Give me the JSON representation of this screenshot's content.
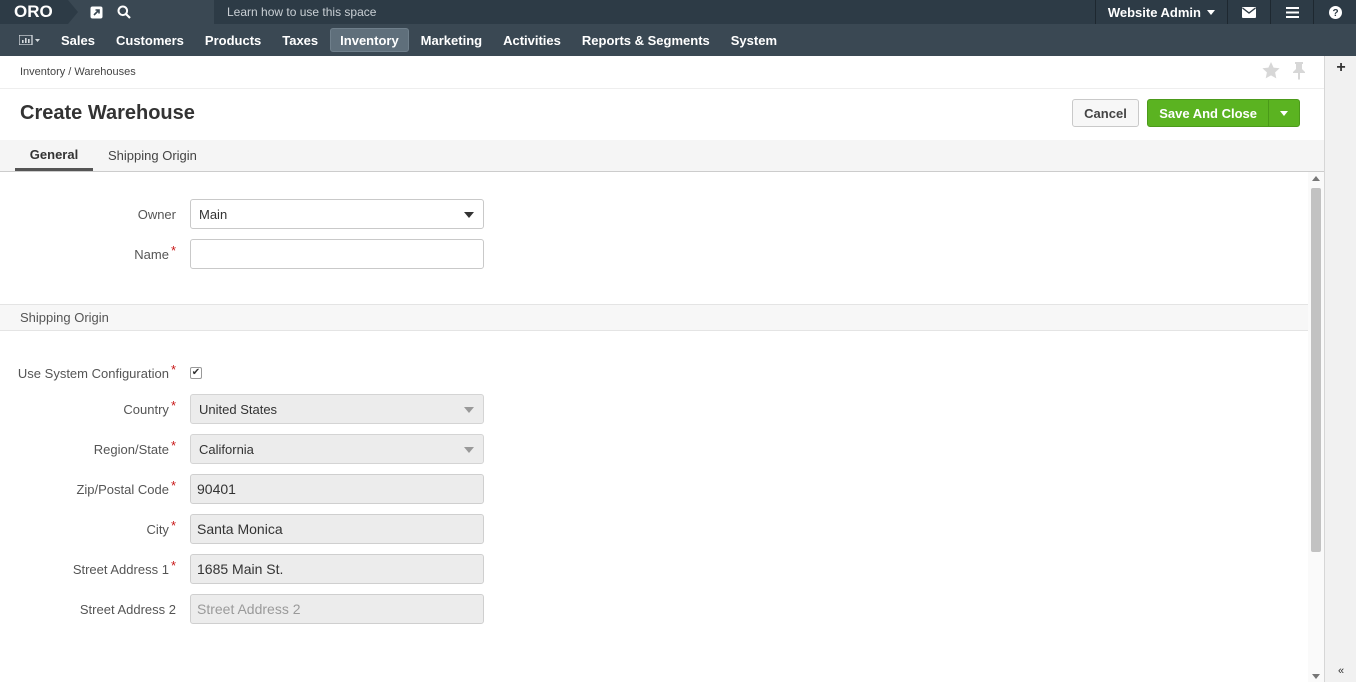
{
  "topbar": {
    "logo": "ORO",
    "search_hint": "Learn how to use this space",
    "user": "Website Admin"
  },
  "nav": {
    "items": [
      {
        "label": "Sales"
      },
      {
        "label": "Customers"
      },
      {
        "label": "Products"
      },
      {
        "label": "Taxes"
      },
      {
        "label": "Inventory"
      },
      {
        "label": "Marketing"
      },
      {
        "label": "Activities"
      },
      {
        "label": "Reports & Segments"
      },
      {
        "label": "System"
      }
    ],
    "active": "Inventory"
  },
  "breadcrumb": "Inventory / Warehouses",
  "page": {
    "title": "Create Warehouse",
    "cancel_label": "Cancel",
    "save_label": "Save And Close"
  },
  "tabs": [
    {
      "label": "General"
    },
    {
      "label": "Shipping Origin"
    }
  ],
  "general": {
    "owner_label": "Owner",
    "owner_value": "Main",
    "name_label": "Name",
    "name_value": ""
  },
  "shipping": {
    "section_title": "Shipping Origin",
    "use_system_label": "Use System Configuration",
    "use_system_checked": true,
    "country_label": "Country",
    "country_value": "United States",
    "region_label": "Region/State",
    "region_value": "California",
    "zip_label": "Zip/Postal Code",
    "zip_value": "90401",
    "city_label": "City",
    "city_value": "Santa Monica",
    "street1_label": "Street Address 1",
    "street1_value": "1685 Main St.",
    "street2_label": "Street Address 2",
    "street2_placeholder": "Street Address 2"
  },
  "colors": {
    "topbar": "#2d3b46",
    "navbar": "#3a4853",
    "save_button": "#5bb321",
    "required": "#c81717"
  }
}
